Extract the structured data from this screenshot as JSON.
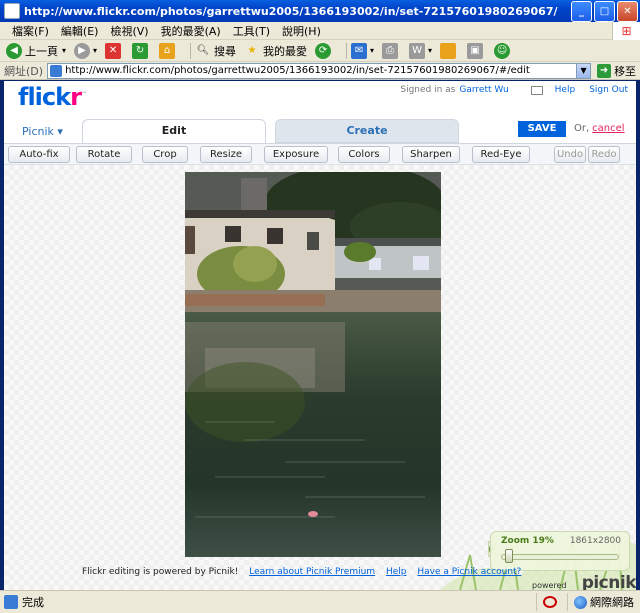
{
  "window": {
    "title": "http://www.flickr.com/photos/garrettwu2005/1366193002/in/set-72157601980269067/",
    "min": "_",
    "max": "□",
    "close": "✕"
  },
  "menu": [
    "檔案(F)",
    "編輯(E)",
    "檢視(V)",
    "我的最愛(A)",
    "工具(T)",
    "說明(H)"
  ],
  "toolbar": {
    "back": "上一頁",
    "search": "搜尋",
    "favorites": "我的最愛"
  },
  "address": {
    "label": "網址(D)",
    "url": "http://www.flickr.com/photos/garrettwu2005/1366193002/in/set-72157601980269067/#/edit",
    "go": "移至"
  },
  "flickr": {
    "logo_blue": "flick",
    "logo_pink": "r",
    "logo_tm": "™",
    "signed_in_as": "Signed in as",
    "user": "Garrett Wu",
    "help": "Help",
    "sign_out": "Sign Out"
  },
  "editor": {
    "picnik_menu": "Picnik ▾",
    "tab_edit": "Edit",
    "tab_create": "Create",
    "save": "SAVE",
    "or": "Or,",
    "cancel": "cancel",
    "tools": [
      "Auto-fix",
      "Rotate",
      "Crop",
      "Resize",
      "Exposure",
      "Colors",
      "Sharpen",
      "Red-Eye"
    ],
    "undo": "Undo",
    "redo": "Redo"
  },
  "footer": {
    "powered_text": "Flickr editing is powered by Picnik!",
    "learn": "Learn about Picnik Premium",
    "help": "Help",
    "account": "Have a Picnik account?",
    "powered_by": "powered by",
    "picnik": "picnik"
  },
  "zoom": {
    "label": "Zoom 19%",
    "resolution": "1861x2800",
    "level_percent": 19,
    "handle_glyph": "▶"
  },
  "status": {
    "text": "完成",
    "zone": "網際網路"
  }
}
